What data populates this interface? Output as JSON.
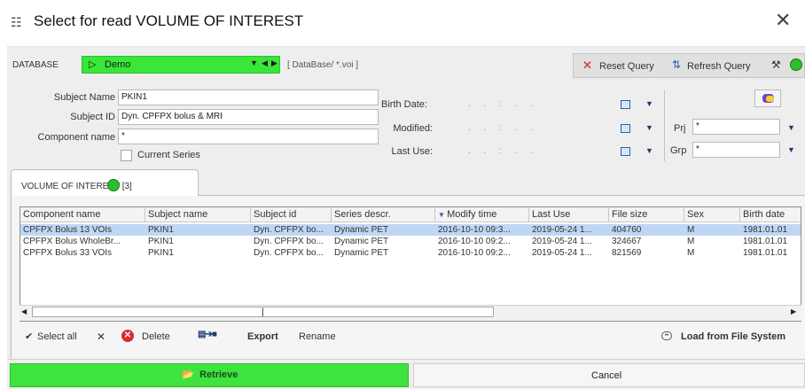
{
  "window": {
    "title": "Select for read VOLUME OF INTEREST",
    "close_icon": "close-icon"
  },
  "database": {
    "label": "DATABASE",
    "selected": "Demo",
    "path": "[ DataBase/ *.voi ]",
    "combo_color": "#39e639"
  },
  "query": {
    "reset_label": "Reset Query",
    "refresh_label": "Refresh Query"
  },
  "subject": {
    "name_label": "Subject Name",
    "name_value": "PKIN1",
    "id_label": "Subject ID",
    "id_value": "Dyn. CPFPX bolus & MRI",
    "component_label": "Component name",
    "component_value": "*",
    "current_series_label": "Current Series",
    "current_series_checked": false
  },
  "dates": {
    "birth_label": "Birth Date:",
    "modified_label": "Modified:",
    "lastuse_label": "Last Use:",
    "placeholder": ". . : . ."
  },
  "filters": {
    "prj_label": "Prj",
    "prj_value": "*",
    "grp_label": "Grp",
    "grp_value": "*"
  },
  "tab": {
    "label": "VOLUME OF INTEREST [3]"
  },
  "table": {
    "columns": [
      "Component name",
      "Subject name",
      "Subject id",
      "Series descr.",
      "Modify time",
      "Last Use",
      "File size",
      "Sex",
      "Birth date"
    ],
    "sort_column": "Modify time",
    "rows": [
      [
        "CPFPX Bolus 13 VOIs",
        "PKIN1",
        "Dyn. CPFPX bo...",
        "Dynamic PET",
        "2016-10-10 09:3...",
        "2019-05-24 1...",
        "404760",
        "M",
        "1981.01.01"
      ],
      [
        "CPFPX Bolus WholeBr...",
        "PKIN1",
        "Dyn. CPFPX bo...",
        "Dynamic PET",
        "2016-10-10 09:2...",
        "2019-05-24 1...",
        "324667",
        "M",
        "1981.01.01"
      ],
      [
        "CPFPX Bolus 33 VOIs",
        "PKIN1",
        "Dyn. CPFPX bo...",
        "Dynamic PET",
        "2016-10-10 09:2...",
        "2019-05-24 1...",
        "821569",
        "M",
        "1981.01.01"
      ]
    ],
    "selected_row": 0,
    "selection_color": "#bfd6f5"
  },
  "actions": {
    "select_all": "Select all",
    "delete": "Delete",
    "export": "Export",
    "rename": "Rename",
    "load_fs": "Load from File System"
  },
  "buttons": {
    "retrieve": "Retrieve",
    "cancel": "Cancel",
    "retrieve_color": "#3fe33f"
  }
}
